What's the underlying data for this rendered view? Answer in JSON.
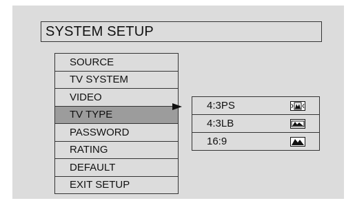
{
  "title": "SYSTEM SETUP",
  "menu": {
    "items": [
      {
        "label": "SOURCE"
      },
      {
        "label": "TV SYSTEM"
      },
      {
        "label": "VIDEO"
      },
      {
        "label": "TV TYPE"
      },
      {
        "label": "PASSWORD"
      },
      {
        "label": "RATING"
      },
      {
        "label": "DEFAULT"
      },
      {
        "label": "EXIT SETUP"
      }
    ],
    "selected_index": 3
  },
  "submenu": {
    "items": [
      {
        "label": "4:3PS",
        "icon": "pan-scan-icon"
      },
      {
        "label": "4:3LB",
        "icon": "letterbox-icon"
      },
      {
        "label": "16:9",
        "icon": "widescreen-icon"
      }
    ]
  },
  "colors": {
    "background": "#dcdcdc",
    "selected_highlight": "#9c9c9c",
    "border": "#333333"
  }
}
